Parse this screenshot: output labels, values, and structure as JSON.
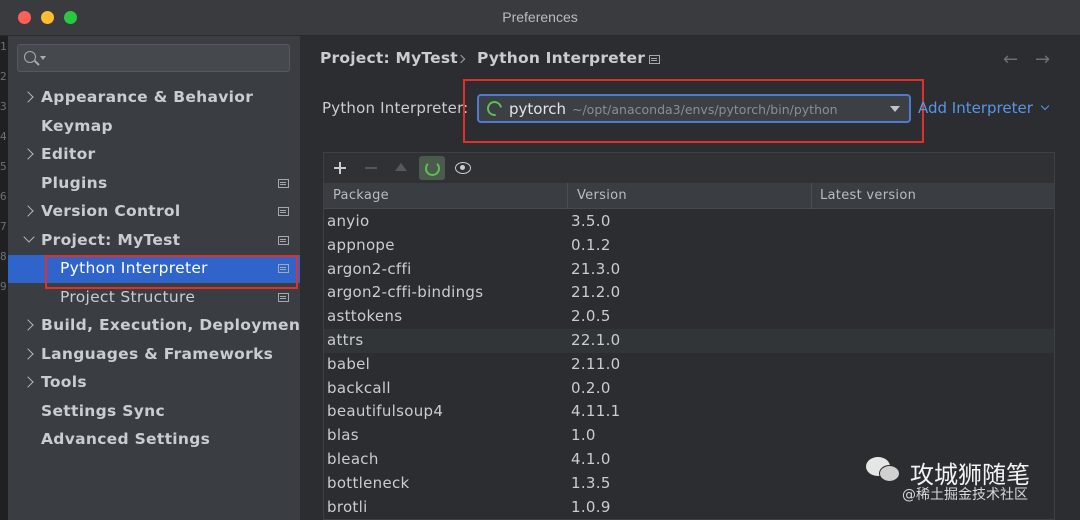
{
  "window": {
    "title": "Preferences"
  },
  "edge_numbers": [
    "1",
    "2",
    "3",
    "4",
    "5",
    "6",
    "7",
    "8",
    "9"
  ],
  "sidebar": {
    "search_placeholder": "",
    "items": [
      {
        "label": "Appearance & Behavior",
        "expandable": true,
        "expanded": false,
        "project_icon": false
      },
      {
        "label": "Keymap",
        "expandable": false,
        "project_icon": false
      },
      {
        "label": "Editor",
        "expandable": true,
        "expanded": false,
        "project_icon": false
      },
      {
        "label": "Plugins",
        "expandable": false,
        "project_icon": true
      },
      {
        "label": "Version Control",
        "expandable": true,
        "expanded": false,
        "project_icon": true
      },
      {
        "label": "Project: MyTest",
        "expandable": true,
        "expanded": true,
        "project_icon": true
      },
      {
        "label": "Python Interpreter",
        "sub": true,
        "selected": true,
        "project_icon": true
      },
      {
        "label": "Project Structure",
        "sub": true,
        "project_icon": true
      },
      {
        "label": "Build, Execution, Deployment",
        "expandable": true,
        "expanded": false,
        "project_icon": false
      },
      {
        "label": "Languages & Frameworks",
        "expandable": true,
        "expanded": false,
        "project_icon": false
      },
      {
        "label": "Tools",
        "expandable": true,
        "expanded": false,
        "project_icon": false
      },
      {
        "label": "Settings Sync",
        "expandable": false,
        "project_icon": false
      },
      {
        "label": "Advanced Settings",
        "expandable": false,
        "project_icon": false
      }
    ]
  },
  "breadcrumb": {
    "project": "Project: MyTest",
    "page": "Python Interpreter"
  },
  "nav": {
    "back": "←",
    "forward": "→"
  },
  "interpreter": {
    "label": "Python Interpreter:",
    "name": "pytorch",
    "path": "~/opt/anaconda3/envs/pytorch/bin/python",
    "add_label": "Add Interpreter"
  },
  "packages": {
    "columns": [
      "Package",
      "Version",
      "Latest version"
    ],
    "rows": [
      {
        "name": "anyio",
        "version": "3.5.0",
        "latest": ""
      },
      {
        "name": "appnope",
        "version": "0.1.2",
        "latest": ""
      },
      {
        "name": "argon2-cffi",
        "version": "21.3.0",
        "latest": ""
      },
      {
        "name": "argon2-cffi-bindings",
        "version": "21.2.0",
        "latest": ""
      },
      {
        "name": "asttokens",
        "version": "2.0.5",
        "latest": ""
      },
      {
        "name": "attrs",
        "version": "22.1.0",
        "latest": "",
        "highlight": true
      },
      {
        "name": "babel",
        "version": "2.11.0",
        "latest": ""
      },
      {
        "name": "backcall",
        "version": "0.2.0",
        "latest": ""
      },
      {
        "name": "beautifulsoup4",
        "version": "4.11.1",
        "latest": ""
      },
      {
        "name": "blas",
        "version": "1.0",
        "latest": ""
      },
      {
        "name": "bleach",
        "version": "4.1.0",
        "latest": ""
      },
      {
        "name": "bottleneck",
        "version": "1.3.5",
        "latest": ""
      },
      {
        "name": "brotli",
        "version": "1.0.9",
        "latest": ""
      }
    ]
  },
  "watermark": {
    "title": "攻城狮随笔",
    "subtitle": "@稀土掘金技术社区"
  },
  "colors": {
    "accent": "#2f65ca",
    "highlight_box": "#e0302a",
    "link": "#5995e6",
    "spinner": "#5cbf57"
  }
}
